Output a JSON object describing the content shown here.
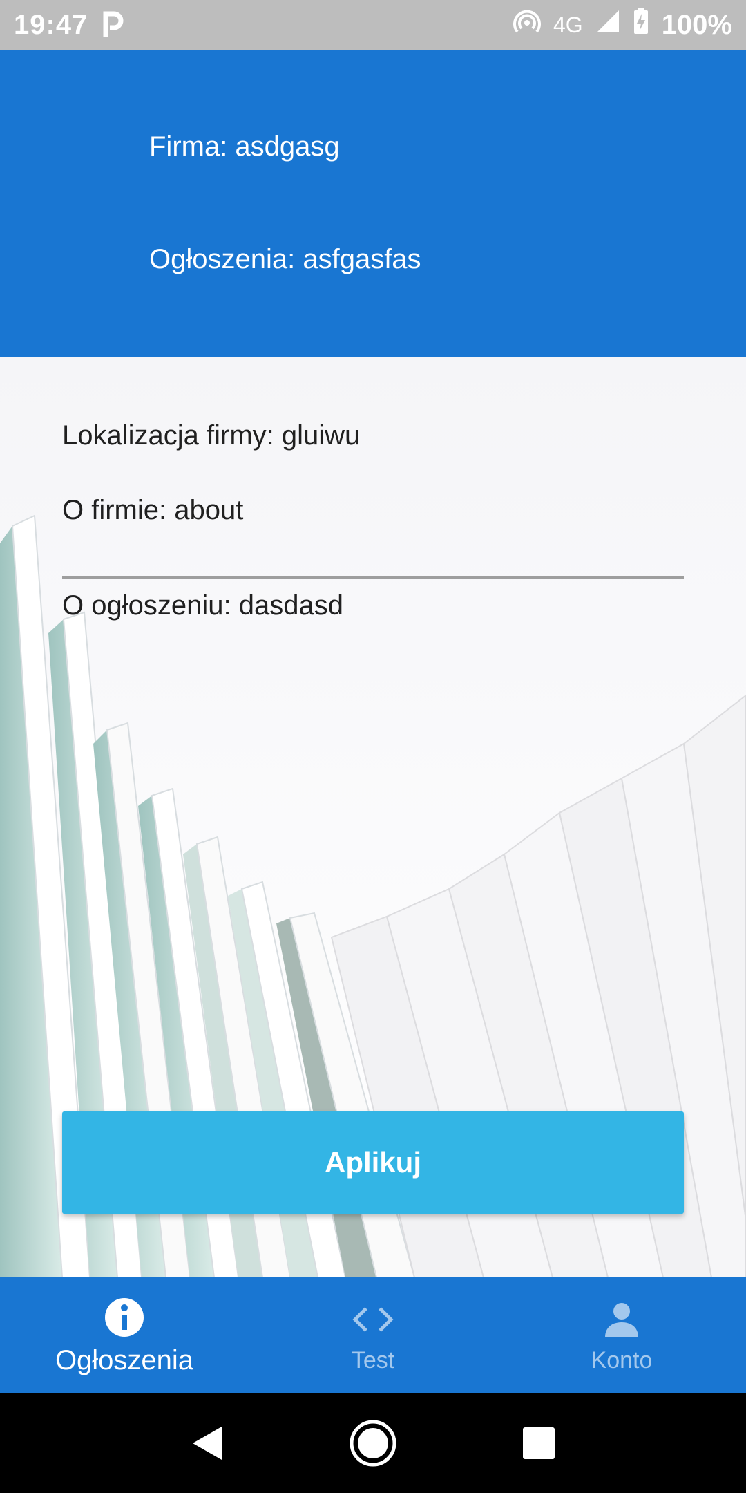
{
  "status_bar": {
    "time": "19:47",
    "app_icon": "p-icon",
    "network": "4G",
    "battery": "100%",
    "icons": [
      "hotspot-icon",
      "signal-icon",
      "battery-charging-icon"
    ]
  },
  "header": {
    "firm": "Firma: asdgasg",
    "ads": "Ogłoszenia: asfgasfas"
  },
  "details": {
    "location": "Lokalizacja firmy: gluiwu",
    "about": "O firmie: about",
    "ad_about": "O ogłoszeniu: dasdasd"
  },
  "apply_button": {
    "label": "Aplikuj"
  },
  "bottom_nav": {
    "items": [
      {
        "label": "Ogłoszenia",
        "icon": "info-icon",
        "active": true
      },
      {
        "label": "Test",
        "icon": "code-icon",
        "active": false
      },
      {
        "label": "Konto",
        "icon": "person-icon",
        "active": false
      }
    ]
  },
  "android_nav": {
    "icons": [
      "back-icon",
      "home-icon",
      "recents-icon"
    ]
  },
  "colors": {
    "primary": "#1976d2",
    "button": "#33b5e5",
    "status_bar": "#bdbdbd"
  }
}
